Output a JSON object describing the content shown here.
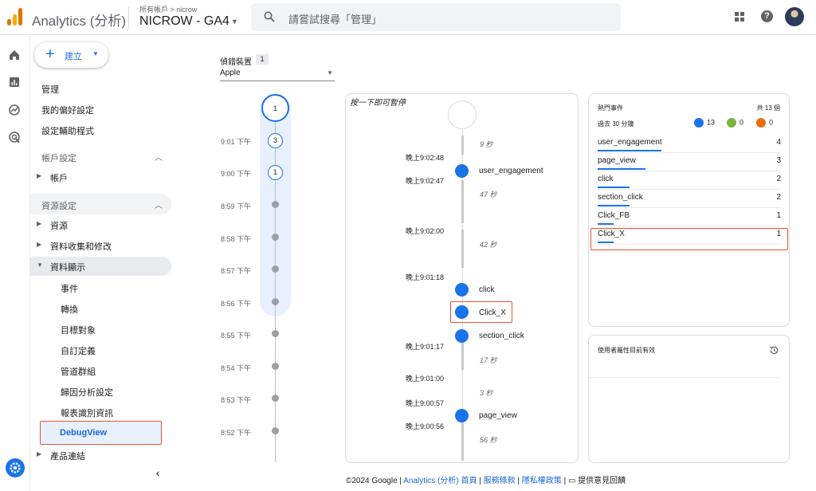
{
  "header": {
    "app_title": "Analytics (分析)",
    "account_crumb": "所有帳戶 > nicrow",
    "property_name": "NICROW - GA4",
    "search_placeholder": "請嘗試搜尋「管理」",
    "icons": [
      "analytics-logo",
      "search-icon",
      "apps-icon",
      "help-icon",
      "avatar"
    ]
  },
  "rail": {
    "icons": [
      "home-icon",
      "reports-icon",
      "explore-icon",
      "advertising-icon",
      "settings-icon"
    ]
  },
  "sidebar": {
    "create_label": "建立",
    "top_items": [
      "管理",
      "我的偏好設定",
      "設定輔助程式"
    ],
    "account_section": {
      "label": "帳戶設定",
      "items": [
        "帳戶"
      ]
    },
    "property_section": {
      "label": "資源設定",
      "items": [
        "資源",
        "資料收集和修改",
        "資料顯示"
      ],
      "data_display_children": [
        "事件",
        "轉換",
        "目標對象",
        "自訂定義",
        "管道群組",
        "歸因分析設定",
        "報表識別資訊",
        "DebugView"
      ],
      "after": [
        "產品連結"
      ]
    }
  },
  "device": {
    "label": "偵錯裝置",
    "count": "1",
    "selected": "Apple"
  },
  "minutes": {
    "top_count": "1",
    "items": [
      {
        "time": "9:01 下午",
        "count": "3"
      },
      {
        "time": "9:00 下午",
        "count": "1"
      },
      {
        "time": "8:59 下午",
        "count": ""
      },
      {
        "time": "8:58 下午",
        "count": ""
      },
      {
        "time": "8:57 下午",
        "count": ""
      },
      {
        "time": "8:56 下午",
        "count": ""
      },
      {
        "time": "8:55 下午",
        "count": ""
      },
      {
        "time": "8:54 下午",
        "count": ""
      },
      {
        "time": "8:53 下午",
        "count": ""
      },
      {
        "time": "8:52 下午",
        "count": ""
      }
    ]
  },
  "stream": {
    "hint": "按一下即可暫停",
    "times": [
      "晚上9:02:48",
      "晚上9:02:47",
      "晚上9:02:00",
      "晚上9:01:18",
      "晚上9:01:17",
      "晚上9:01:00",
      "晚上9:00:57",
      "晚上9:00:56"
    ],
    "gaps": [
      "9 秒",
      "47 秒",
      "42 秒",
      "17 秒",
      "3 秒",
      "56 秒"
    ],
    "events": [
      "user_engagement",
      "click",
      "Click_X",
      "section_click",
      "page_view"
    ]
  },
  "top_events": {
    "title": "熱門事件",
    "total": "共 13 個",
    "range": "過去 30 分鐘",
    "tallies": [
      {
        "icon": "event-icon",
        "color": "#1a73e8",
        "value": "13"
      },
      {
        "icon": "flag-icon",
        "color": "#7cb342",
        "value": "0"
      },
      {
        "icon": "error-icon",
        "color": "#e8710a",
        "value": "0"
      }
    ],
    "rows": [
      {
        "name": "user_engagement",
        "count": "4",
        "fraction": 1.0
      },
      {
        "name": "page_view",
        "count": "3",
        "fraction": 0.75
      },
      {
        "name": "click",
        "count": "2",
        "fraction": 0.5
      },
      {
        "name": "section_click",
        "count": "2",
        "fraction": 0.5
      },
      {
        "name": "Click_FB",
        "count": "1",
        "fraction": 0.25
      },
      {
        "name": "Click_X",
        "count": "1",
        "fraction": 0.25
      }
    ]
  },
  "user_props": {
    "title": "使用者屬性目前有效"
  },
  "footer": {
    "copyright": "©2024 Google | ",
    "home_link": "Analytics (分析) 首頁",
    "sep1": " | ",
    "terms_link": "服務條款",
    "sep2": " | ",
    "privacy_link": "隱私權政策",
    "sep3": " | ",
    "feedback": "提供意見回饋"
  },
  "colors": {
    "accent": "#1a73e8",
    "highlight_box": "#e8542f"
  }
}
